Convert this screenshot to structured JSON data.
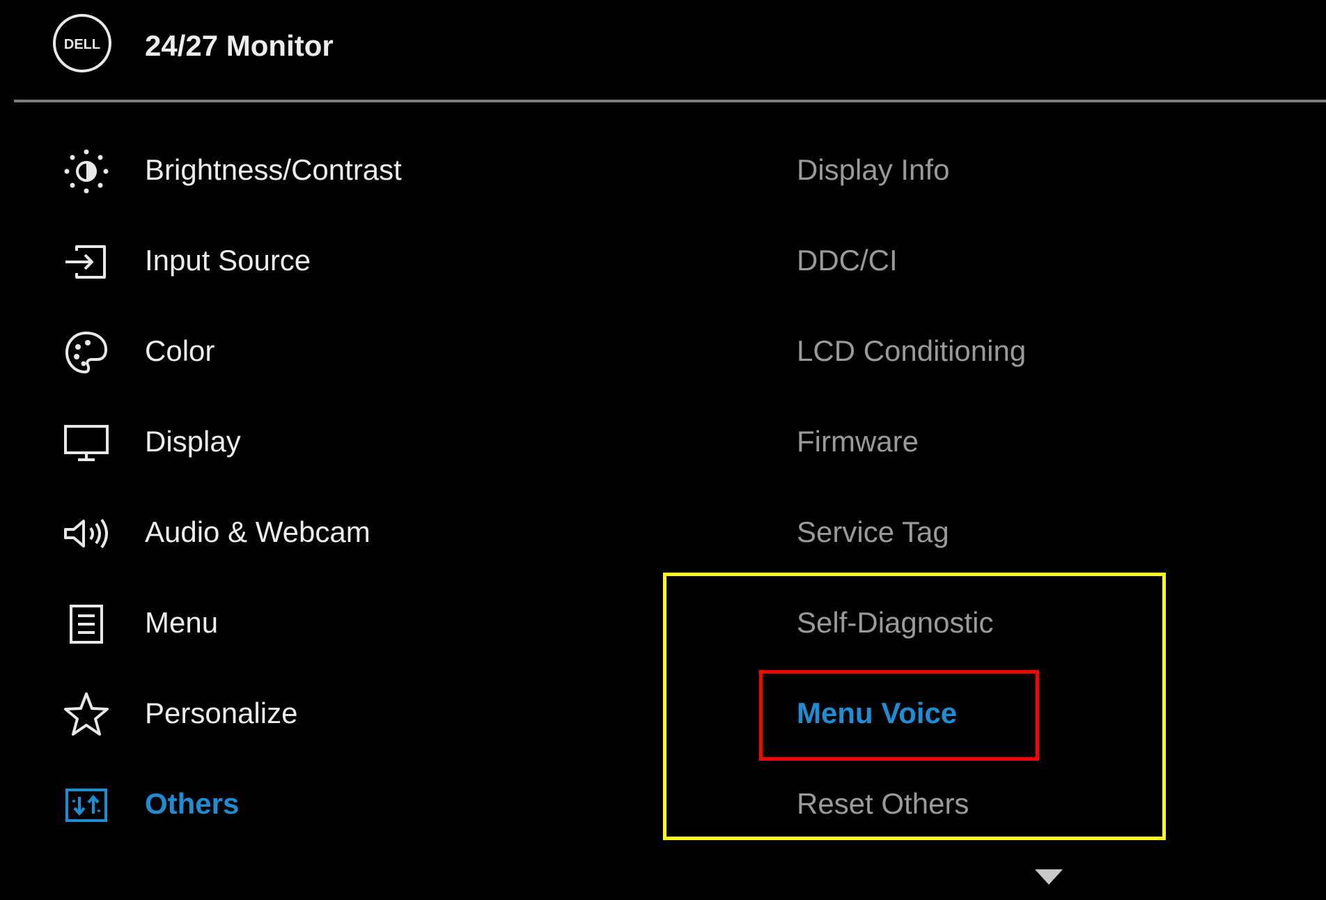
{
  "header": {
    "logo_text": "DELL",
    "title": "24/27 Monitor"
  },
  "main_menu": {
    "items": [
      {
        "label": "Brightness/Contrast",
        "icon": "brightness-icon"
      },
      {
        "label": "Input Source",
        "icon": "input-source-icon"
      },
      {
        "label": "Color",
        "icon": "palette-icon"
      },
      {
        "label": "Display",
        "icon": "monitor-icon"
      },
      {
        "label": "Audio & Webcam",
        "icon": "speaker-icon"
      },
      {
        "label": "Menu",
        "icon": "menu-list-icon"
      },
      {
        "label": "Personalize",
        "icon": "star-icon"
      },
      {
        "label": "Others",
        "icon": "others-icon",
        "active": true
      }
    ]
  },
  "sub_menu": {
    "items": [
      {
        "label": "Display Info"
      },
      {
        "label": "DDC/CI"
      },
      {
        "label": "LCD Conditioning"
      },
      {
        "label": "Firmware"
      },
      {
        "label": "Service Tag"
      },
      {
        "label": "Self-Diagnostic"
      },
      {
        "label": "Menu Voice",
        "active": true
      },
      {
        "label": "Reset Others"
      }
    ]
  },
  "colors": {
    "background": "#000000",
    "text": "#ededed",
    "submenu_text": "#9a9a9a",
    "accent": "#1a8fd6",
    "highlight_yellow": "#ffff00",
    "highlight_red": "#ff0000"
  }
}
